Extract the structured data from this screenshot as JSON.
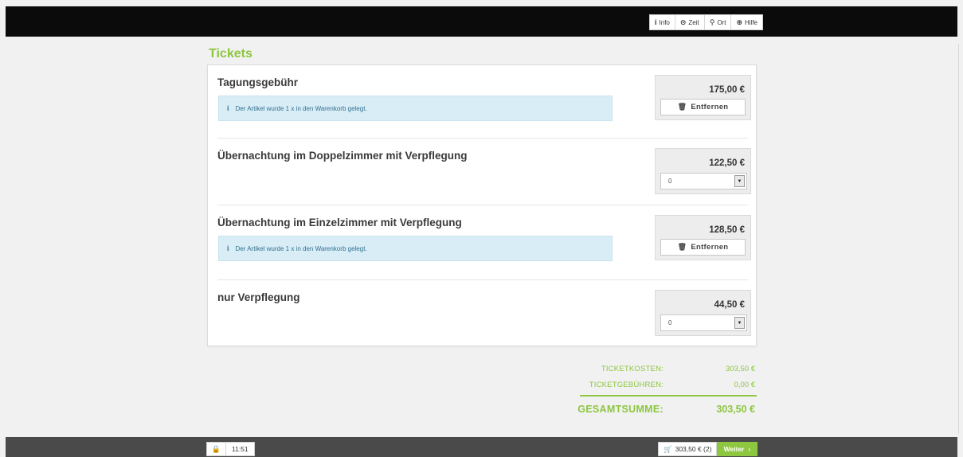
{
  "topnav": {
    "items": [
      {
        "icon": "info-icon",
        "glyph": "i",
        "label": "Info"
      },
      {
        "icon": "clock-icon",
        "glyph": "⊙",
        "label": "Zeit"
      },
      {
        "icon": "map-pin-icon",
        "glyph": "⚲",
        "label": "Ort"
      },
      {
        "icon": "lifebuoy-icon",
        "glyph": "⊕",
        "label": "Hilfe"
      }
    ]
  },
  "section": {
    "title": "Tickets"
  },
  "tickets": [
    {
      "name": "Tagungsgebühr",
      "price": "175,00 €",
      "in_cart": true,
      "notice": "Der Artikel wurde 1 x in den Warenkorb gelegt.",
      "action_label": "Entfernen"
    },
    {
      "name": "Übernachtung im Doppelzimmer mit Verpflegung",
      "price": "122,50 €",
      "in_cart": false,
      "quantity": "0"
    },
    {
      "name": "Übernachtung im Einzelzimmer mit Verpflegung",
      "price": "128,50 €",
      "in_cart": true,
      "notice": "Der Artikel wurde 1 x in den Warenkorb gelegt.",
      "action_label": "Entfernen"
    },
    {
      "name": "nur Verpflegung",
      "price": "44,50 €",
      "in_cart": false,
      "quantity": "0"
    }
  ],
  "summary": {
    "ticket_cost_label": "TICKETKOSTEN:",
    "ticket_cost_value": "303,50 €",
    "ticket_fee_label": "TICKETGEBÜHREN:",
    "ticket_fee_value": "0,00 €",
    "total_label": "GESAMTSUMME:",
    "total_value": "303,50 €"
  },
  "footer": {
    "timer": "11:51",
    "cart_label": "303,50 € (2)",
    "next_label": "Weiter"
  },
  "colors": {
    "accent": "#8dc63f",
    "notice_bg": "#d9edf7",
    "topbar": "#0b0b0b",
    "bottombar": "#4a4a4a"
  }
}
